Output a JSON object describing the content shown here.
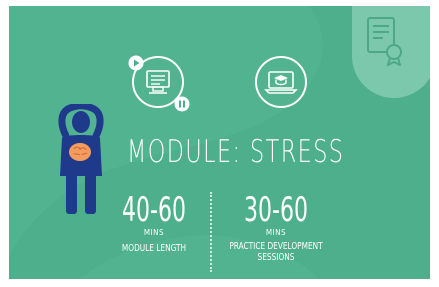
{
  "module": {
    "title": "MODULE: STRESS",
    "stats": [
      {
        "value": "40-60",
        "unit": "MINS",
        "label": "MODULE LENGTH"
      },
      {
        "value": "30-60",
        "unit": "MINS",
        "label": "PRACTICE DEVELOPMENT SESSIONS"
      }
    ]
  },
  "icons": {
    "left": "video-lesson-icon",
    "right": "laptop-graduation-icon",
    "corner": "certificate-icon",
    "figure": "stressed-person-icon"
  },
  "colors": {
    "background": "#4daf8c",
    "accent_light": "#7cc8ad",
    "figure_blue": "#1f3a8a",
    "brain_orange": "#f59b5d"
  }
}
